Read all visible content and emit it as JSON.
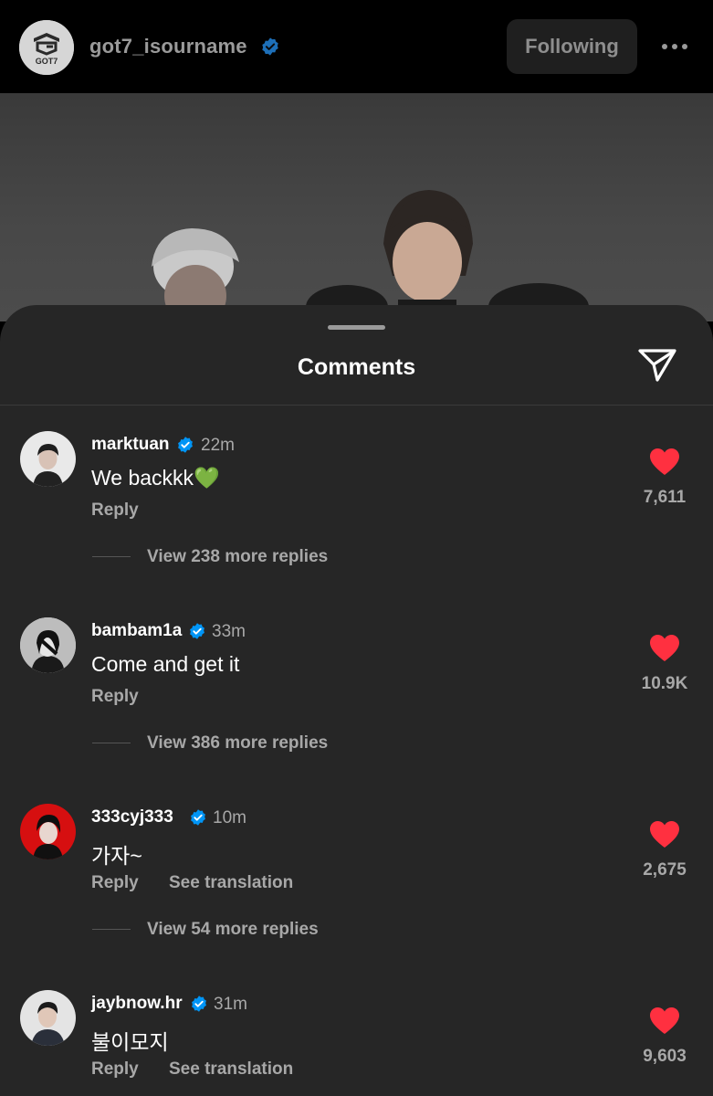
{
  "header": {
    "username": "got7_isourname",
    "avatar_logo_text": "GOT7",
    "following_label": "Following",
    "more_icon": "more-horizontal-icon"
  },
  "sheet": {
    "title": "Comments",
    "share_icon": "send-icon"
  },
  "colors": {
    "sheet_bg": "#262626",
    "verified_blue": "#0095f6",
    "heart_red": "#ff3040",
    "secondary_text": "#a8a8a8"
  },
  "comments": [
    {
      "username": "marktuan",
      "verified": true,
      "time": "22m",
      "text": "We backkk",
      "emoji": "💚",
      "reply_label": "Reply",
      "view_replies": "View 238 more replies",
      "likes": "7,611",
      "liked": true
    },
    {
      "username": "bambam1a",
      "verified": true,
      "time": "33m",
      "text": "Come and get it",
      "reply_label": "Reply",
      "view_replies": "View 386 more replies",
      "likes": "10.9K",
      "liked": true
    },
    {
      "username": "333cyj333",
      "verified": true,
      "time": "10m",
      "text": "가자~",
      "reply_label": "Reply",
      "translate_label": "See translation",
      "view_replies": "View 54 more replies",
      "likes": "2,675",
      "liked": true
    },
    {
      "username": "jaybnow.hr",
      "verified": true,
      "time": "31m",
      "text": "불이모지",
      "reply_label": "Reply",
      "translate_label": "See translation",
      "likes": "9,603",
      "liked": true
    }
  ]
}
